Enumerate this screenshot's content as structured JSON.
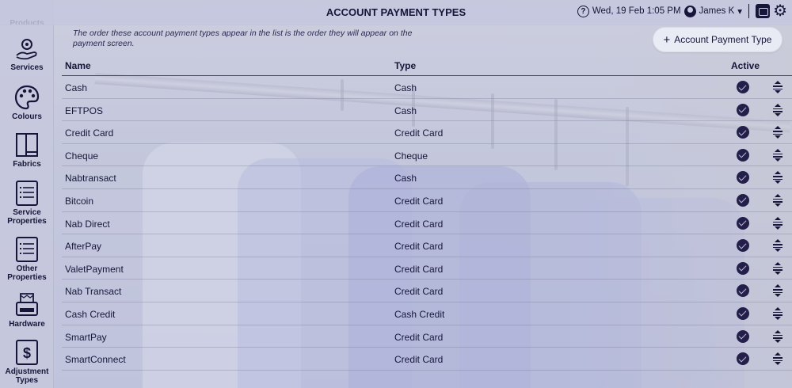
{
  "header": {
    "title": "ACCOUNT PAYMENT TYPES",
    "help_icon": "question-circle-icon",
    "datetime": "Wed, 19 Feb 1:05 PM",
    "user_name": "James K",
    "user_chevron": "▾"
  },
  "sidebar": {
    "items": [
      {
        "label": "Products",
        "icon": "products-icon"
      },
      {
        "label": "Services",
        "icon": "services-icon"
      },
      {
        "label": "Colours",
        "icon": "palette-icon"
      },
      {
        "label": "Fabrics",
        "icon": "fabric-icon"
      },
      {
        "label": "Service Properties",
        "icon": "list-doc-icon"
      },
      {
        "label": "Other Properties",
        "icon": "list-doc-icon"
      },
      {
        "label": "Hardware",
        "icon": "printer-icon"
      },
      {
        "label": "Adjustment Types",
        "icon": "dollar-icon"
      }
    ]
  },
  "main": {
    "note": "The order these account payment types appear in the list is the order they will appear on the payment screen.",
    "add_button": {
      "plus": "+",
      "label": "Account Payment Type"
    },
    "columns": {
      "name": "Name",
      "type": "Type",
      "active": "Active"
    },
    "rows": [
      {
        "name": "Cash",
        "type": "Cash",
        "active": true
      },
      {
        "name": "EFTPOS",
        "type": "Cash",
        "active": true
      },
      {
        "name": "Credit Card",
        "type": "Credit Card",
        "active": true
      },
      {
        "name": "Cheque",
        "type": "Cheque",
        "active": true
      },
      {
        "name": "Nabtransact",
        "type": "Cash",
        "active": true
      },
      {
        "name": "Bitcoin",
        "type": "Credit Card",
        "active": true
      },
      {
        "name": "Nab Direct",
        "type": "Credit Card",
        "active": true
      },
      {
        "name": "AfterPay",
        "type": "Credit Card",
        "active": true
      },
      {
        "name": "ValetPayment",
        "type": "Credit Card",
        "active": true
      },
      {
        "name": "Nab Transact",
        "type": "Credit Card",
        "active": true
      },
      {
        "name": "Cash Credit",
        "type": "Cash Credit",
        "active": true
      },
      {
        "name": "SmartPay",
        "type": "Credit Card",
        "active": true
      },
      {
        "name": "SmartConnect",
        "type": "Credit Card",
        "active": true
      }
    ]
  },
  "colors": {
    "primary": "#17163a",
    "overlay": "#ced0e4",
    "check": "#231f4a"
  }
}
